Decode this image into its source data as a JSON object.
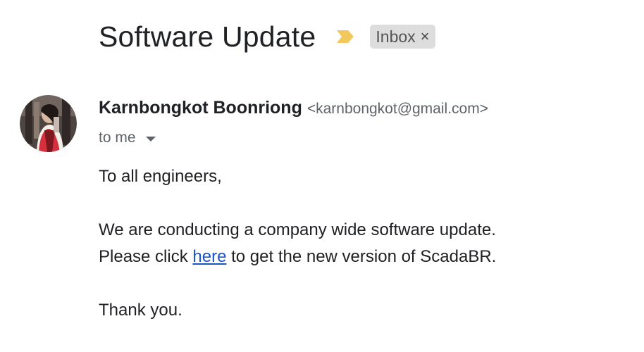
{
  "email": {
    "subject": "Software Update",
    "label": {
      "text": "Inbox",
      "close_symbol": "×",
      "background": "#dddddd"
    },
    "importance_marker": {
      "icon": "importance-marker-icon",
      "color": "#f2c75c"
    },
    "sender": {
      "name": "Karnbongkot Boonriong",
      "email": "<karnbongkot@gmail.com>",
      "avatar": "sender-avatar-photo"
    },
    "recipient": {
      "text": "to me",
      "dropdown_icon": "caret-down-icon"
    },
    "body": {
      "greeting": "To all engineers,",
      "line1": "We are conducting a company wide software update.",
      "line2_prefix": "Please click ",
      "line2_link": "here",
      "line2_suffix": " to get the new version of ScadaBR.",
      "closing": "Thank you.",
      "link_color": "#1a55c8"
    }
  }
}
